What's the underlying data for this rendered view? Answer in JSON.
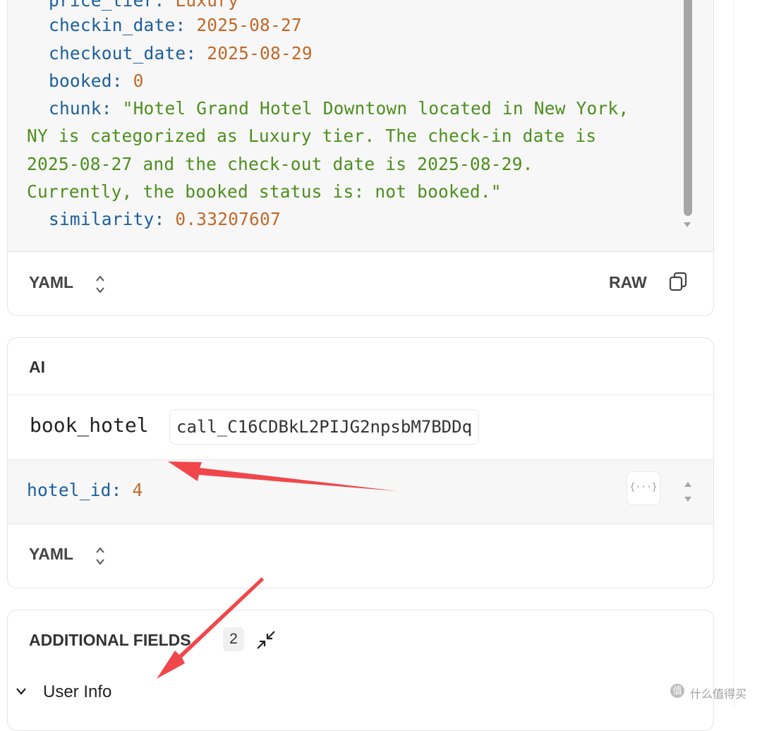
{
  "yaml_result": {
    "lines": [
      {
        "key": "price_tier:",
        "value": "Luxury"
      },
      {
        "key": "checkin_date:",
        "value": "2025-08-27"
      },
      {
        "key": "checkout_date:",
        "value": "2025-08-29"
      },
      {
        "key": "booked:",
        "value": "0"
      },
      {
        "key": "chunk:",
        "value": "\"Hotel Grand Hotel Downtown located in New York,"
      },
      {
        "value": "NY is categorized as Luxury tier. The check-in date is"
      },
      {
        "value": "2025-08-27 and the check-out date is 2025-08-29."
      },
      {
        "value": "Currently, the booked status is: not booked.\""
      },
      {
        "key": "similarity:",
        "value": "0.33207607"
      }
    ],
    "format_label": "YAML",
    "raw_label": "RAW"
  },
  "ai_card": {
    "title": "AI",
    "tool_name": "book_hotel",
    "call_id": "call_C16CDBkL2PIJG2npsbM7BDDq",
    "arg_key": "hotel_id:",
    "arg_value": "4",
    "json_button": "{···}",
    "format_label": "YAML"
  },
  "additional_fields": {
    "title": "ADDITIONAL FIELDS",
    "count": "2",
    "user_info_label": "User Info"
  },
  "watermark": {
    "icon": "值",
    "text": "什么值得买"
  },
  "colors": {
    "key": "#1b5f9c",
    "value_orange": "#c0692a",
    "string_green": "#4c8f1e",
    "annotation_arrow": "#f0474b"
  }
}
